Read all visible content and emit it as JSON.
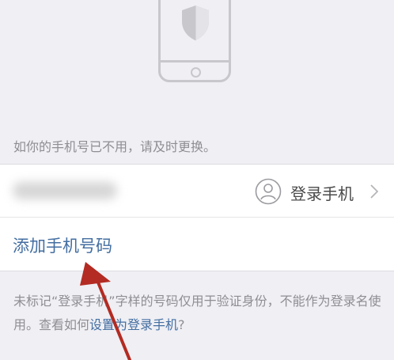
{
  "hint_top": "如你的手机号已不用，请及时更换。",
  "phone_row": {
    "login_label": "登录手机"
  },
  "add_phone": {
    "label": "添加手机号码"
  },
  "note": {
    "text_before": "未标记“登录手机”字样的号码仅用于验证身份，不能作为登录名使用。查看如何",
    "link": "设置为登录手机",
    "text_after": "?"
  },
  "colors": {
    "background": "#efeff4",
    "link": "#436ea1",
    "secondary_text": "#8e8e93",
    "annotation_arrow": "#b32b22"
  },
  "icons": {
    "illustration": "phone-shield-icon",
    "account": "person-icon",
    "disclosure": "chevron-right-icon"
  }
}
